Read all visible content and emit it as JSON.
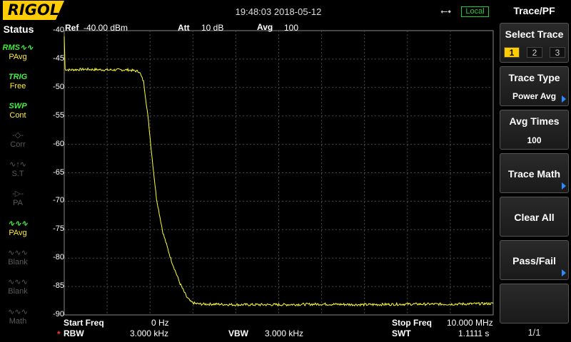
{
  "header": {
    "logo": "RIGOL",
    "datetime": "19:48:03 2018-05-12",
    "usb_icon": "usb-icon",
    "local_label": "Local"
  },
  "status": {
    "title": "Status",
    "items": [
      {
        "glyph": "RMS∿∿",
        "label": "PAvg",
        "active": true
      },
      {
        "glyph": "TRIG",
        "label": "Free",
        "active": true
      },
      {
        "glyph": "SWP",
        "label": "Cont",
        "active": true
      },
      {
        "glyph": "-◇-",
        "label": "Corr",
        "active": false
      },
      {
        "glyph": "∿↑∿",
        "label": "S.T",
        "active": false
      },
      {
        "glyph": "-▷-",
        "label": "PA",
        "active": false
      },
      {
        "glyph": "∿∿∿",
        "label": "PAvg",
        "active": true
      },
      {
        "glyph": "∿∿∿",
        "label": "Blank",
        "active": false
      },
      {
        "glyph": "∿∿∿",
        "label": "Blank",
        "active": false
      },
      {
        "glyph": "∿∿∿",
        "label": "Math",
        "active": false
      }
    ]
  },
  "plot_header": {
    "ref_label": "Ref",
    "ref_value": "-40.00 dBm",
    "att_label": "Att",
    "att_value": "10 dB",
    "avg_label": "Avg",
    "avg_value": "100"
  },
  "bottom": {
    "start_label": "Start Freq",
    "start_value": "0 Hz",
    "stop_label": "Stop Freq",
    "stop_value": "10.000 MHz",
    "rbw_marker": "*",
    "rbw_label": "RBW",
    "rbw_value": "3.000 kHz",
    "vbw_label": "VBW",
    "vbw_value": "3.000 kHz",
    "swt_label": "SWT",
    "swt_value": "1.1111 s"
  },
  "menu": {
    "title": "Trace/PF",
    "select_trace_label": "Select Trace",
    "select_trace_options": [
      "1",
      "2",
      "3"
    ],
    "selected_trace": "1",
    "trace_type_label": "Trace Type",
    "trace_type_value": "Power Avg",
    "avg_times_label": "Avg Times",
    "avg_times_value": "100",
    "trace_math_label": "Trace Math",
    "clear_all_label": "Clear All",
    "pass_fail_label": "Pass/Fail",
    "page_indicator": "1/1"
  },
  "colors": {
    "trace": "#ffff33",
    "logo_bg": "#ffcc00",
    "local_green": "#22cc33",
    "menu_arrow": "#2b8cff",
    "grid": "#4a4a4a"
  },
  "chart_data": {
    "type": "line",
    "x_unit": "MHz",
    "y_unit": "dBm",
    "xlim": [
      0,
      10
    ],
    "ylim": [
      -90,
      -40
    ],
    "y_ticks": [
      "-40",
      "-45",
      "-50",
      "-55",
      "-60",
      "-65",
      "-70",
      "-75",
      "-80",
      "-85",
      "-90"
    ],
    "grid": true,
    "series": [
      {
        "x": [
          0,
          0.02,
          0.1,
          0.5,
          1.0,
          1.5,
          1.75,
          1.85,
          1.95,
          2.05,
          2.15,
          2.3,
          2.5,
          2.7,
          2.85,
          2.95,
          3.05,
          3.2,
          3.5,
          4.0,
          5.0,
          6.0,
          7.0,
          8.0,
          9.0,
          10.0
        ],
        "y": [
          -41.0,
          -46.8,
          -46.9,
          -46.8,
          -46.9,
          -46.9,
          -47.2,
          -49.0,
          -55.0,
          -62.5,
          -69.5,
          -75.5,
          -80.5,
          -84.5,
          -86.8,
          -87.7,
          -88.0,
          -88.1,
          -88.1,
          -88.2,
          -88.2,
          -88.1,
          -88.2,
          -88.1,
          -88.1,
          -88.0
        ]
      }
    ]
  }
}
